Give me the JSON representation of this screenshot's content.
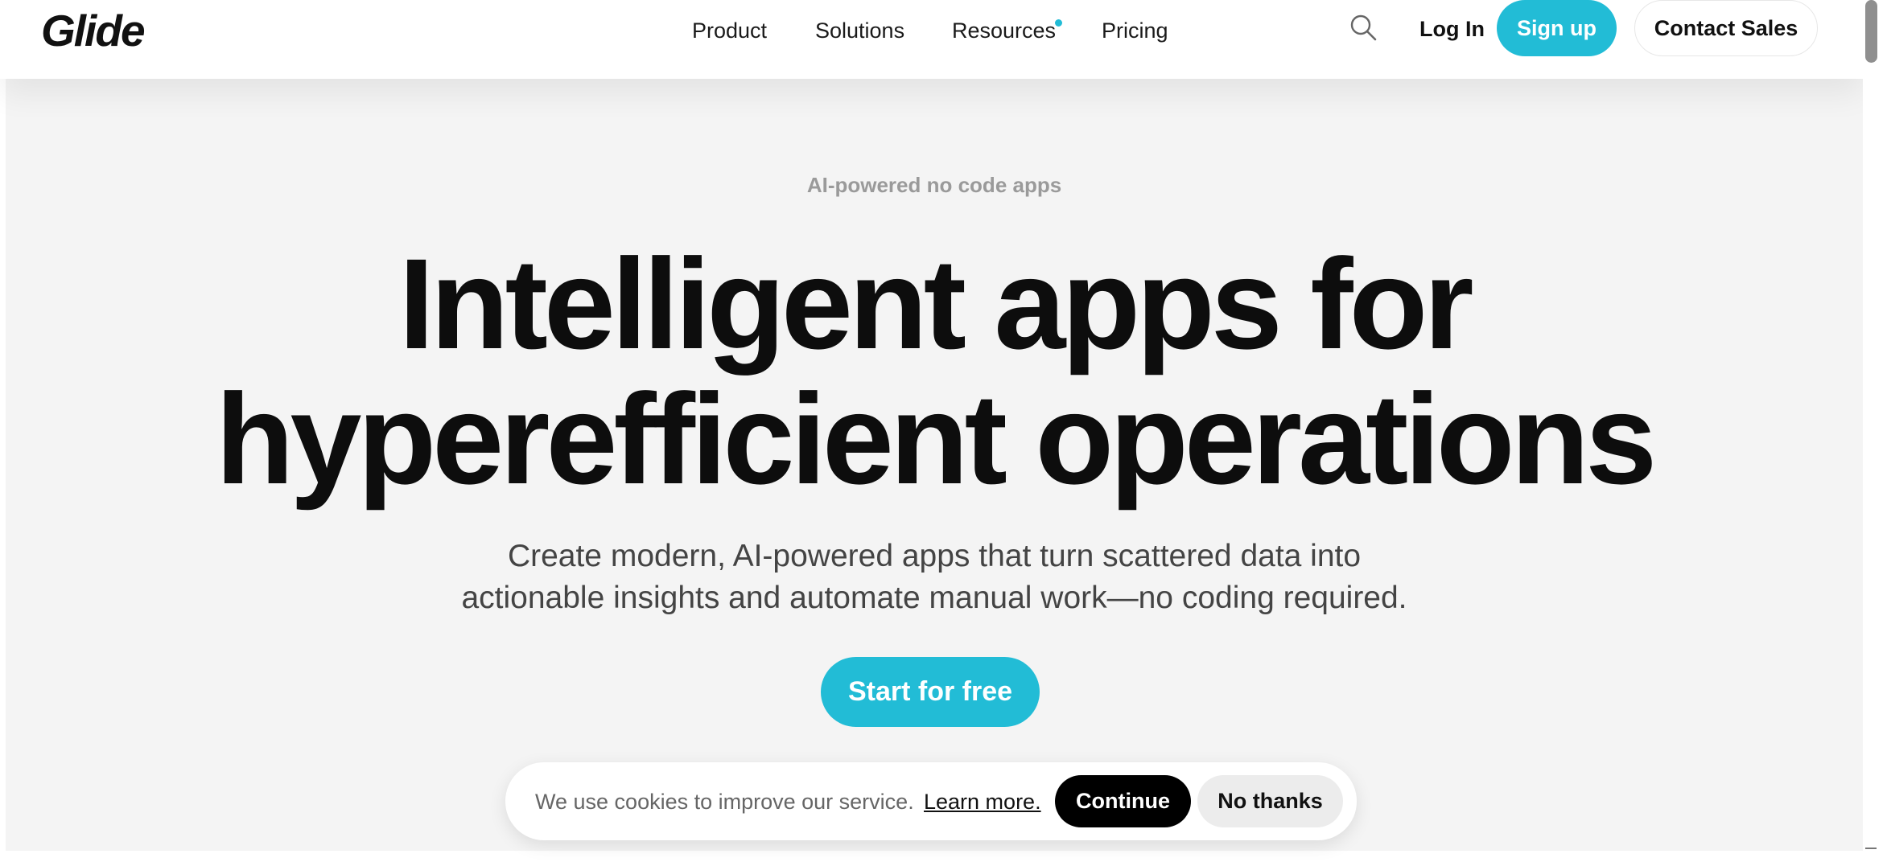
{
  "header": {
    "logo": "Glide",
    "nav": [
      {
        "label": "Product"
      },
      {
        "label": "Solutions"
      },
      {
        "label": "Resources"
      },
      {
        "label": "Pricing"
      }
    ],
    "login_label": "Log In",
    "signup_label": "Sign up",
    "contact_label": "Contact Sales",
    "search_icon": "search-icon"
  },
  "hero": {
    "eyebrow": "AI-powered no code apps",
    "headline_line1": "Intelligent apps for",
    "headline_line2": "hyperefficient operations",
    "subtext_line1": "Create modern, AI-powered apps that turn scattered data into",
    "subtext_line2": "actionable insights and automate manual work—no coding required.",
    "cta_label": "Start for free"
  },
  "cookie_banner": {
    "text": "We use cookies to improve our service.",
    "learn_more": "Learn more.",
    "continue_label": "Continue",
    "no_thanks_label": "No thanks"
  },
  "colors": {
    "accent": "#22bcd6",
    "hero_background": "#f4f4f4",
    "text_primary": "#0d0d0d"
  }
}
